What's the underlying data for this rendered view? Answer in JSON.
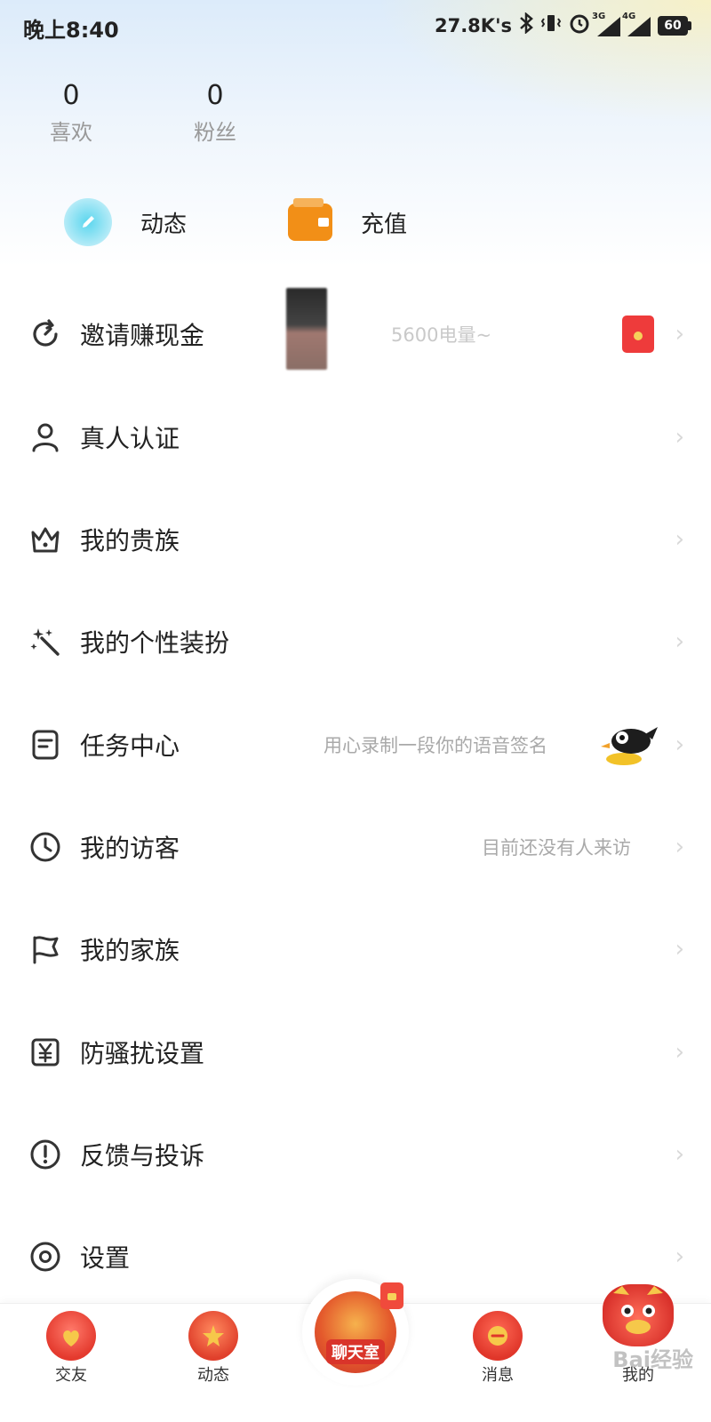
{
  "status_bar": {
    "time": "晚上8:40",
    "speed": "27.8K's",
    "signal_3g": "3G",
    "signal_4g": "4G",
    "battery": "60"
  },
  "stats": [
    {
      "value": "0",
      "label": "喜欢"
    },
    {
      "value": "0",
      "label": "粉丝"
    }
  ],
  "quick_actions": {
    "dynamics": "动态",
    "recharge": "充值"
  },
  "menu": [
    {
      "id": "invite",
      "label": "邀请赚现金",
      "hint": "5600电量~",
      "icon": "refresh-icon"
    },
    {
      "id": "verify",
      "label": "真人认证",
      "hint": "",
      "icon": "user-icon"
    },
    {
      "id": "noble",
      "label": "我的贵族",
      "hint": "",
      "icon": "crown-icon"
    },
    {
      "id": "style",
      "label": "我的个性装扮",
      "hint": "",
      "icon": "magic-wand-icon"
    },
    {
      "id": "tasks",
      "label": "任务中心",
      "hint": "用心录制一段你的语音签名",
      "icon": "document-icon"
    },
    {
      "id": "visitors",
      "label": "我的访客",
      "hint": "目前还没有人来访",
      "icon": "clock-icon"
    },
    {
      "id": "family",
      "label": "我的家族",
      "hint": "",
      "icon": "flag-icon"
    },
    {
      "id": "antiharass",
      "label": "防骚扰设置",
      "hint": "",
      "icon": "yen-icon"
    },
    {
      "id": "feedback",
      "label": "反馈与投诉",
      "hint": "",
      "icon": "alert-icon"
    },
    {
      "id": "settings",
      "label": "设置",
      "hint": "",
      "icon": "settings-icon"
    }
  ],
  "bottom_nav": [
    {
      "label": "交友",
      "icon": "friend-icon"
    },
    {
      "label": "动态",
      "icon": "dynamics-icon"
    },
    {
      "label": "聊天室",
      "icon": "chatroom-icon"
    },
    {
      "label": "消息",
      "icon": "message-icon"
    },
    {
      "label": "我的",
      "icon": "me-icon"
    }
  ],
  "watermark": "Bai经验",
  "colors": {
    "accent_orange": "#f28f17",
    "accent_cyan": "#5bd6ee",
    "red": "#ee3b3b"
  }
}
